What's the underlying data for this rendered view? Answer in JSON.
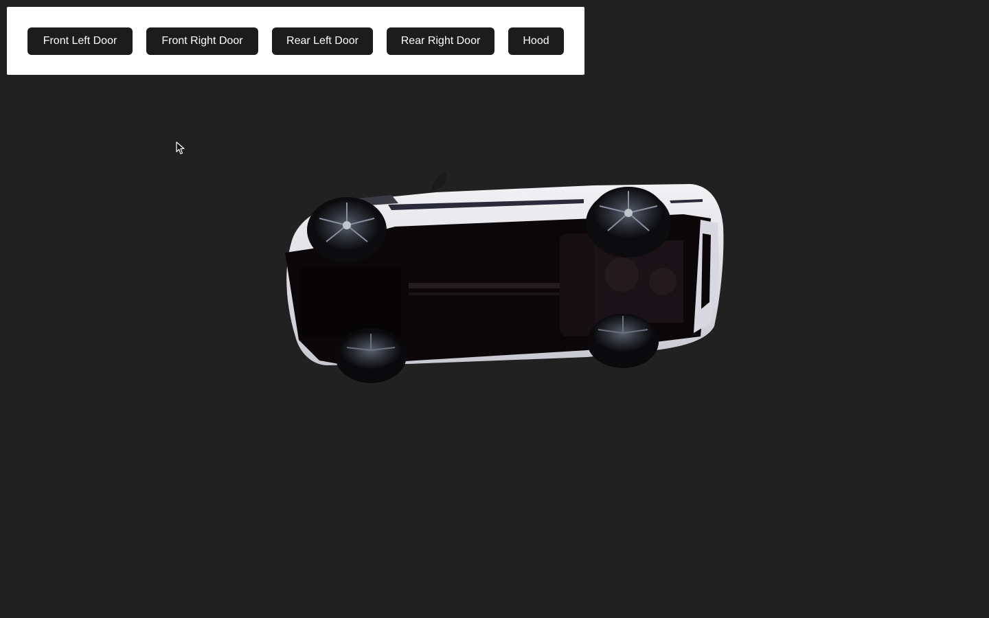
{
  "toolbar": {
    "buttons": [
      {
        "label": "Front Left Door"
      },
      {
        "label": "Front Right Door"
      },
      {
        "label": "Rear Left Door"
      },
      {
        "label": "Rear Right Door"
      },
      {
        "label": "Hood"
      }
    ]
  },
  "scene": {
    "background_color": "#212121",
    "car_body_color": "#e8e8ec",
    "object": "car-model-underside-view"
  },
  "icons": {
    "cursor": "mouse-pointer-icon"
  }
}
